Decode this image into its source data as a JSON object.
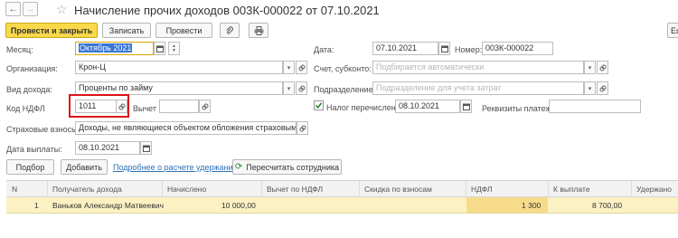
{
  "header": {
    "title": "Начисление прочих доходов 003К-000022 от 07.10.2021",
    "back_label": "←",
    "forward_label": "→",
    "star": "☆"
  },
  "toolbar": {
    "post_close": "Провести и закрыть",
    "save": "Записать",
    "post": "Провести",
    "attach_icon": "paperclip-icon",
    "print_icon": "printer-icon",
    "right_cut": "Еш"
  },
  "form": {
    "month_label": "Месяц:",
    "month_value": "Октябрь 2021",
    "date_label": "Дата:",
    "date_value": "07.10.2021",
    "number_label": "Номер:",
    "number_value": "003К-000022",
    "org_label": "Организация:",
    "org_value": "Крон-Ц",
    "account_label": "Счет, субконто:",
    "account_placeholder": "Подбирается автоматически",
    "income_label": "Вид дохода:",
    "income_value": "Проценты по займу",
    "dept_label": "Подразделение:",
    "dept_placeholder": "Подразделение для учета затрат",
    "ndfl_label": "Код НДФЛ",
    "ndfl_value": "1011",
    "deduction_label": "Вычет",
    "deduction_value": "",
    "tax_transferred_label": "Налог перечислен:",
    "tax_transferred_checked": true,
    "tax_date_value": "08.10.2021",
    "payment_details_label": "Реквизиты платежа:",
    "insurance_label": "Страховые взносы:",
    "insurance_value": "Доходы, не являющиеся объектом обложения страховыми взно",
    "payout_label": "Дата выплаты:",
    "payout_value": "08.10.2021"
  },
  "grid_toolbar": {
    "select": "Подбор",
    "add": "Добавить",
    "details_link": "Подробнее о расчете удержаний",
    "recalc": "Пересчитать сотрудника"
  },
  "table": {
    "columns": [
      "N",
      "Получатель дохода",
      "Начислено",
      "Вычет по НДФЛ",
      "Скидка по взносам",
      "НДФЛ",
      "К выплате",
      "Удержано"
    ],
    "rows": [
      {
        "n": "1",
        "recipient": "Ваньков Александр Матвеевич",
        "accrued": "10 000,00",
        "deduction": "",
        "discount": "",
        "ndfl": "1 300",
        "payout": "8 700,00",
        "withheld": ""
      }
    ]
  },
  "colors": {
    "primary_button": "#f9d84a",
    "highlight_box": "#d9141a",
    "link": "#2b6fb6",
    "selected_row": "#fbf1c3"
  }
}
